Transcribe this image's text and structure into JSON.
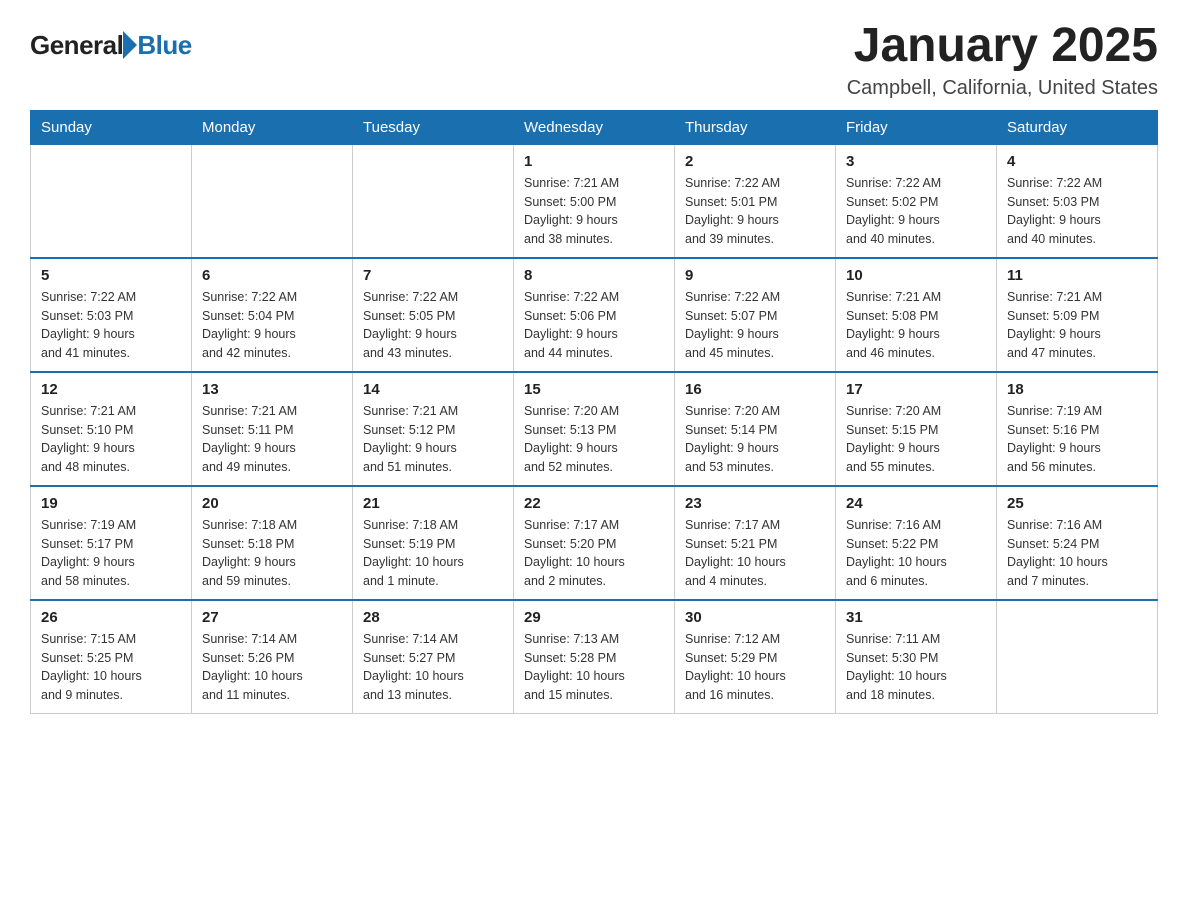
{
  "header": {
    "logo_general": "General",
    "logo_blue": "Blue",
    "month_title": "January 2025",
    "location": "Campbell, California, United States"
  },
  "weekdays": [
    "Sunday",
    "Monday",
    "Tuesday",
    "Wednesday",
    "Thursday",
    "Friday",
    "Saturday"
  ],
  "weeks": [
    [
      {
        "day": "",
        "info": ""
      },
      {
        "day": "",
        "info": ""
      },
      {
        "day": "",
        "info": ""
      },
      {
        "day": "1",
        "info": "Sunrise: 7:21 AM\nSunset: 5:00 PM\nDaylight: 9 hours\nand 38 minutes."
      },
      {
        "day": "2",
        "info": "Sunrise: 7:22 AM\nSunset: 5:01 PM\nDaylight: 9 hours\nand 39 minutes."
      },
      {
        "day": "3",
        "info": "Sunrise: 7:22 AM\nSunset: 5:02 PM\nDaylight: 9 hours\nand 40 minutes."
      },
      {
        "day": "4",
        "info": "Sunrise: 7:22 AM\nSunset: 5:03 PM\nDaylight: 9 hours\nand 40 minutes."
      }
    ],
    [
      {
        "day": "5",
        "info": "Sunrise: 7:22 AM\nSunset: 5:03 PM\nDaylight: 9 hours\nand 41 minutes."
      },
      {
        "day": "6",
        "info": "Sunrise: 7:22 AM\nSunset: 5:04 PM\nDaylight: 9 hours\nand 42 minutes."
      },
      {
        "day": "7",
        "info": "Sunrise: 7:22 AM\nSunset: 5:05 PM\nDaylight: 9 hours\nand 43 minutes."
      },
      {
        "day": "8",
        "info": "Sunrise: 7:22 AM\nSunset: 5:06 PM\nDaylight: 9 hours\nand 44 minutes."
      },
      {
        "day": "9",
        "info": "Sunrise: 7:22 AM\nSunset: 5:07 PM\nDaylight: 9 hours\nand 45 minutes."
      },
      {
        "day": "10",
        "info": "Sunrise: 7:21 AM\nSunset: 5:08 PM\nDaylight: 9 hours\nand 46 minutes."
      },
      {
        "day": "11",
        "info": "Sunrise: 7:21 AM\nSunset: 5:09 PM\nDaylight: 9 hours\nand 47 minutes."
      }
    ],
    [
      {
        "day": "12",
        "info": "Sunrise: 7:21 AM\nSunset: 5:10 PM\nDaylight: 9 hours\nand 48 minutes."
      },
      {
        "day": "13",
        "info": "Sunrise: 7:21 AM\nSunset: 5:11 PM\nDaylight: 9 hours\nand 49 minutes."
      },
      {
        "day": "14",
        "info": "Sunrise: 7:21 AM\nSunset: 5:12 PM\nDaylight: 9 hours\nand 51 minutes."
      },
      {
        "day": "15",
        "info": "Sunrise: 7:20 AM\nSunset: 5:13 PM\nDaylight: 9 hours\nand 52 minutes."
      },
      {
        "day": "16",
        "info": "Sunrise: 7:20 AM\nSunset: 5:14 PM\nDaylight: 9 hours\nand 53 minutes."
      },
      {
        "day": "17",
        "info": "Sunrise: 7:20 AM\nSunset: 5:15 PM\nDaylight: 9 hours\nand 55 minutes."
      },
      {
        "day": "18",
        "info": "Sunrise: 7:19 AM\nSunset: 5:16 PM\nDaylight: 9 hours\nand 56 minutes."
      }
    ],
    [
      {
        "day": "19",
        "info": "Sunrise: 7:19 AM\nSunset: 5:17 PM\nDaylight: 9 hours\nand 58 minutes."
      },
      {
        "day": "20",
        "info": "Sunrise: 7:18 AM\nSunset: 5:18 PM\nDaylight: 9 hours\nand 59 minutes."
      },
      {
        "day": "21",
        "info": "Sunrise: 7:18 AM\nSunset: 5:19 PM\nDaylight: 10 hours\nand 1 minute."
      },
      {
        "day": "22",
        "info": "Sunrise: 7:17 AM\nSunset: 5:20 PM\nDaylight: 10 hours\nand 2 minutes."
      },
      {
        "day": "23",
        "info": "Sunrise: 7:17 AM\nSunset: 5:21 PM\nDaylight: 10 hours\nand 4 minutes."
      },
      {
        "day": "24",
        "info": "Sunrise: 7:16 AM\nSunset: 5:22 PM\nDaylight: 10 hours\nand 6 minutes."
      },
      {
        "day": "25",
        "info": "Sunrise: 7:16 AM\nSunset: 5:24 PM\nDaylight: 10 hours\nand 7 minutes."
      }
    ],
    [
      {
        "day": "26",
        "info": "Sunrise: 7:15 AM\nSunset: 5:25 PM\nDaylight: 10 hours\nand 9 minutes."
      },
      {
        "day": "27",
        "info": "Sunrise: 7:14 AM\nSunset: 5:26 PM\nDaylight: 10 hours\nand 11 minutes."
      },
      {
        "day": "28",
        "info": "Sunrise: 7:14 AM\nSunset: 5:27 PM\nDaylight: 10 hours\nand 13 minutes."
      },
      {
        "day": "29",
        "info": "Sunrise: 7:13 AM\nSunset: 5:28 PM\nDaylight: 10 hours\nand 15 minutes."
      },
      {
        "day": "30",
        "info": "Sunrise: 7:12 AM\nSunset: 5:29 PM\nDaylight: 10 hours\nand 16 minutes."
      },
      {
        "day": "31",
        "info": "Sunrise: 7:11 AM\nSunset: 5:30 PM\nDaylight: 10 hours\nand 18 minutes."
      },
      {
        "day": "",
        "info": ""
      }
    ]
  ]
}
